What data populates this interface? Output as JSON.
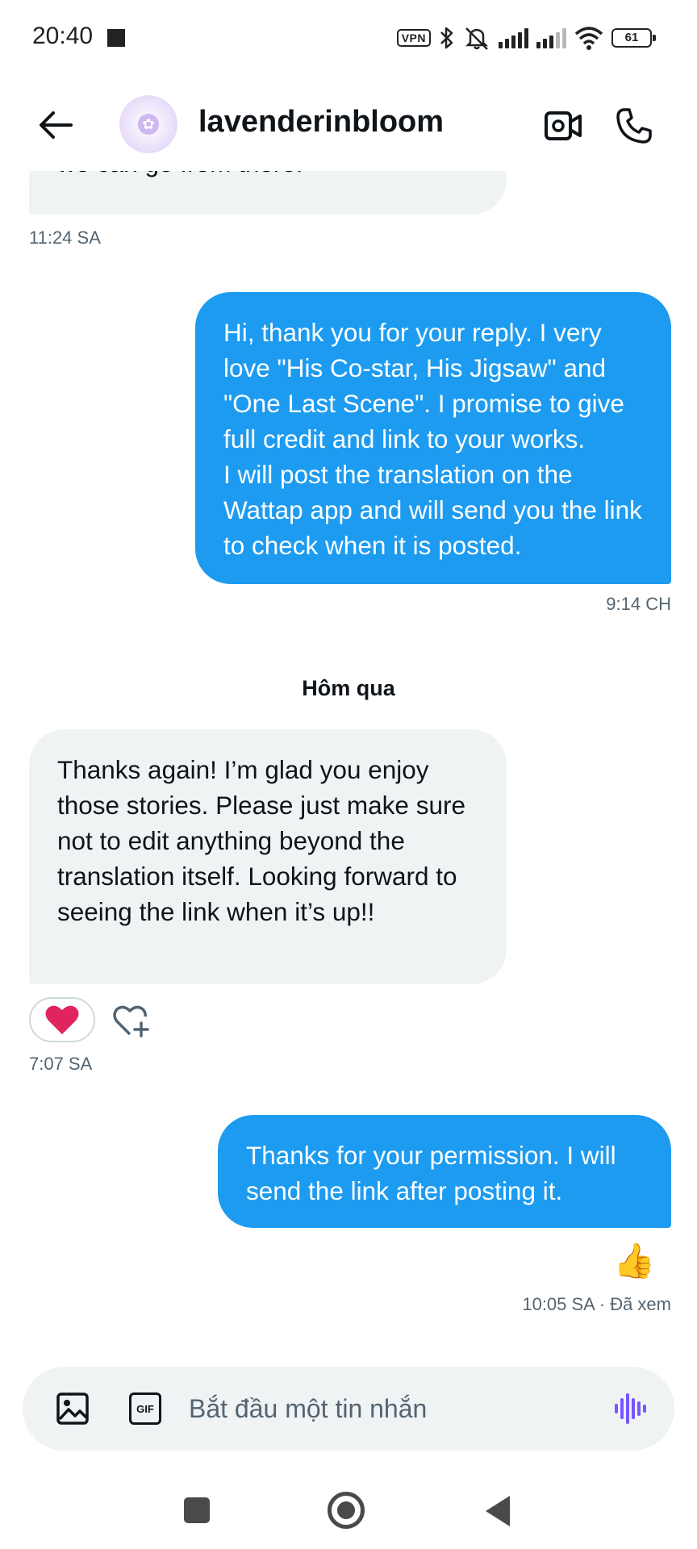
{
  "status_bar": {
    "time": "20:40",
    "vpn": "VPN",
    "battery": "61"
  },
  "header": {
    "contact_name": "lavenderinbloom",
    "icons": [
      "back-arrow-icon",
      "video-call-icon",
      "phone-icon"
    ]
  },
  "messages": [
    {
      "direction": "in",
      "text": "we can go from there!",
      "time": "11:24 SA"
    },
    {
      "direction": "out",
      "text": "Hi, thank you for your reply. I very love \"His Co-star, His Jigsaw\" and \"One Last Scene\". I promise to give full credit and link to your works.\nI will post the translation on the Wattap app and will send you the link to check when it is posted.",
      "time": "9:14 CH"
    },
    {
      "direction": "in",
      "text": "Thanks again! I’m glad you enjoy those stories. Please just make sure not to edit anything beyond the translation itself. Looking forward to seeing the link when it’s up!!",
      "time": "7:07 SA",
      "reaction": "❤️"
    },
    {
      "direction": "out",
      "text": "Thanks for your permission. I will send the link after posting it.",
      "time": "10:05 SA · Đã xem",
      "reaction": "👍"
    }
  ],
  "day_separator": "Hôm qua",
  "composer": {
    "placeholder": "Bắt đầu một tin nhắn",
    "gif_label": "GIF"
  },
  "colors": {
    "outgoing_bubble": "#1d9bf0",
    "incoming_bubble": "#eff3f4",
    "voice_accent": "#7856ff",
    "heart": "#e0245e"
  }
}
